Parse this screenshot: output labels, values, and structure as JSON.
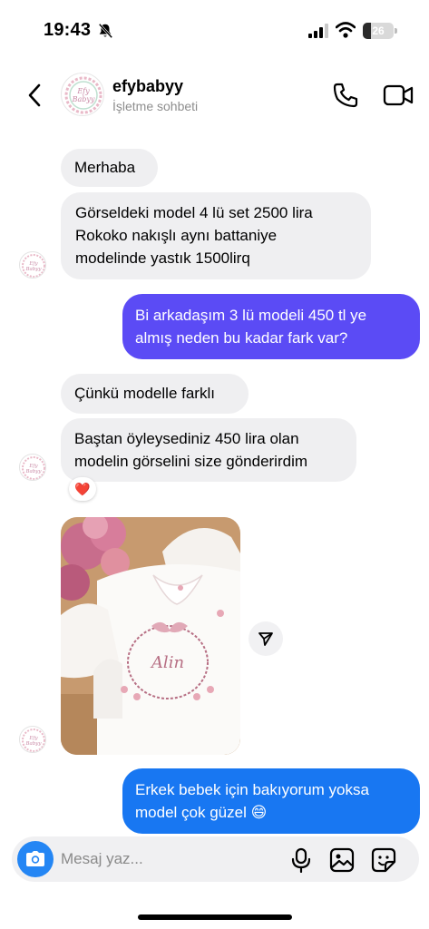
{
  "status_bar": {
    "time": "19:43",
    "battery_level": "26",
    "battery_fraction": 0.26
  },
  "header": {
    "contact_name": "efybabyy",
    "subtitle": "İşletme sohbeti",
    "icons": [
      "back-chevron-icon",
      "phone-icon",
      "video-camera-icon"
    ]
  },
  "messages": [
    {
      "from": "business",
      "text": "Merhaba"
    },
    {
      "from": "business",
      "text": "Görseldeki model 4 lü set 2500 lira\nRokoko nakışlı aynı battaniye\nmodelinde yastık 1500lirq"
    },
    {
      "from": "me",
      "text": "Bi arkadaşım 3 lü modeli 450 tl ye\nalmış neden bu kadar fark var?"
    },
    {
      "from": "business",
      "text": "Çünkü modelle farklı"
    },
    {
      "from": "business",
      "text": "Baştan öyleysediniz 450 lira olan\nmodelin görselini size gönderirdim",
      "reaction": "❤️"
    },
    {
      "from": "business",
      "type": "photo",
      "description_icon": "photo-thumbnail"
    },
    {
      "from": "me",
      "text": "Erkek bebek için bakıyorum yoksa\nmodel çok güzel 😄"
    }
  ],
  "composer": {
    "placeholder": "Mesaj yaz...",
    "icons": [
      "camera-icon",
      "microphone-icon",
      "gallery-icon",
      "sticker-icon"
    ]
  },
  "colors": {
    "outgoing_purple": "#5b4bf5",
    "outgoing_blue": "#1877f2",
    "incoming_gray": "#efeff1",
    "camera_blue": "#2486f4"
  }
}
